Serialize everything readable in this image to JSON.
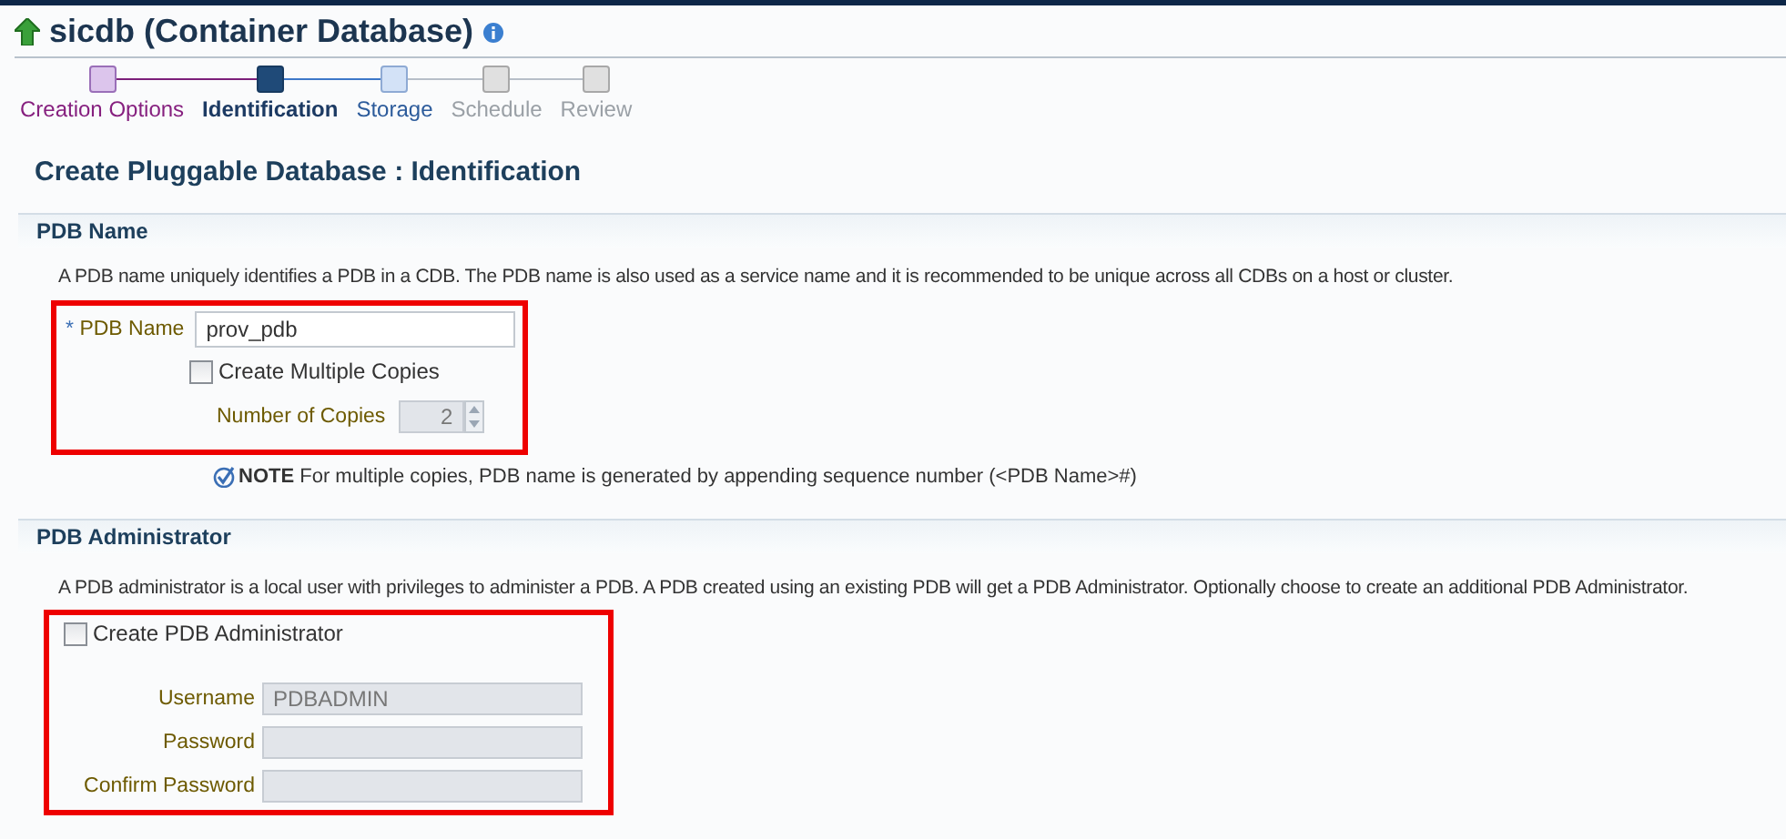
{
  "page": {
    "title": "sicdb (Container Database)"
  },
  "train": [
    {
      "label": "Creation Options",
      "kind": "visited",
      "selected": false
    },
    {
      "label": "Identification",
      "kind": "current",
      "selected": true
    },
    {
      "label": "Storage",
      "kind": "next",
      "selected": false
    },
    {
      "label": "Schedule",
      "kind": "disabled",
      "selected": false
    },
    {
      "label": "Review",
      "kind": "disabled",
      "selected": false
    }
  ],
  "heading": "Create Pluggable Database : Identification",
  "pdb_name_section": {
    "title": "PDB Name",
    "description": "A PDB name uniquely identifies a PDB in a CDB. The PDB name is also used as a service name and it is recommended to be unique across all CDBs on a host or cluster.",
    "highlighted": true,
    "pdb_name": {
      "required_mark": "*",
      "label": "PDB Name",
      "value": "prov_pdb"
    },
    "multiple_copies": {
      "label": "Create Multiple Copies",
      "checked": false
    },
    "number_of_copies": {
      "label": "Number of Copies",
      "value": "2",
      "disabled": true
    },
    "note": "**NOTE** For multiple copies, PDB name is generated by appending sequence number (<PDB Name>#)"
  },
  "admin_section": {
    "title": "PDB Administrator",
    "description": "A PDB administrator is a local user with privileges to administer a PDB. A PDB created using an existing PDB will get a PDB Administrator. Optionally choose to create an additional PDB Administrator.",
    "highlighted": true,
    "create_admin": {
      "label": "Create PDB Administrator",
      "checked": false
    },
    "fields": [
      {
        "label": "Username",
        "value": "PDBADMIN",
        "disabled": true
      },
      {
        "label": "Password",
        "disabled": true
      },
      {
        "label": "Confirm Password",
        "disabled": true
      }
    ]
  }
}
